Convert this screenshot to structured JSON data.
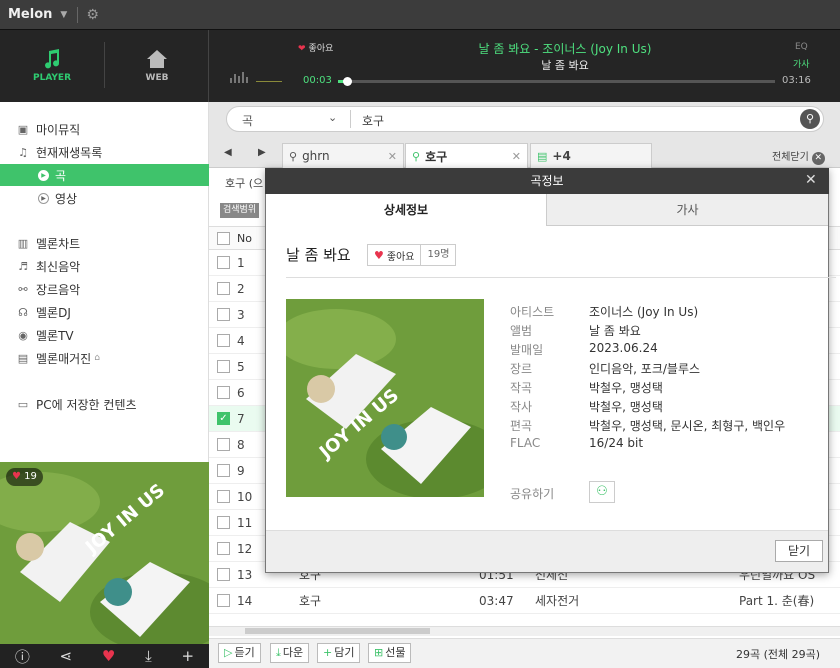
{
  "app": {
    "title": "Melon"
  },
  "player_modes": {
    "player": "PLAYER",
    "web": "WEB"
  },
  "now_playing": {
    "like_label": "좋아요",
    "song_line": "날 좀 봐요 - 조이너스 (Joy In Us)",
    "album_line": "날 좀 봐요",
    "current_time": "00:03",
    "total_time": "03:16",
    "progress": 0.015,
    "eq_label": "EQ",
    "lyrics_label": "가사"
  },
  "sidebar": {
    "my_music": "마이뮤직",
    "now_playlist": "현재재생목록",
    "sub_song": "곡",
    "sub_video": "영상",
    "items": [
      {
        "label": "멜론차트",
        "icon": "chart-icon"
      },
      {
        "label": "최신음악",
        "icon": "music-note-icon"
      },
      {
        "label": "장르음악",
        "icon": "genre-icon"
      },
      {
        "label": "멜론DJ",
        "icon": "headphones-icon"
      },
      {
        "label": "멜론TV",
        "icon": "tv-icon"
      },
      {
        "label": "멜론매거진",
        "icon": "magazine-icon"
      }
    ],
    "pc_content": "PC에 저장한 컨텐츠",
    "art_likes": "19"
  },
  "search": {
    "category": "곡",
    "query": "호구"
  },
  "tabs": [
    {
      "label": "ghrn"
    },
    {
      "label": "호구"
    },
    {
      "label": "+4"
    }
  ],
  "close_all": "전체닫기",
  "result_info": "호구 (으",
  "scope_label": "검색범위",
  "table": {
    "col_no": "No",
    "rows": [
      {
        "no": "1"
      },
      {
        "no": "2"
      },
      {
        "no": "3"
      },
      {
        "no": "4"
      },
      {
        "no": "5"
      },
      {
        "no": "6"
      },
      {
        "no": "7"
      },
      {
        "no": "8"
      },
      {
        "no": "9"
      },
      {
        "no": "10"
      },
      {
        "no": "11"
      },
      {
        "no": "12"
      },
      {
        "no": "13",
        "title": "호구",
        "time": "01:51",
        "artist": "전체전",
        "album": "우린일까요 OS"
      },
      {
        "no": "14",
        "title": "호구",
        "time": "03:47",
        "artist": "세자전거",
        "album": "Part 1. 춘(春)"
      }
    ]
  },
  "bottom": {
    "listen": "듣기",
    "download": "다운",
    "add": "담기",
    "gift": "선물",
    "count": "29곡 (전체 29곡)"
  },
  "modal": {
    "title": "곡정보",
    "tab_detail": "상세정보",
    "tab_lyrics": "가사",
    "song_title": "날 좀 봐요",
    "like_label": "좋아요",
    "like_count": "19명",
    "details": [
      {
        "label": "아티스트",
        "value": "조이너스 (Joy In Us)"
      },
      {
        "label": "앨범",
        "value": "날 좀 봐요"
      },
      {
        "label": "발매일",
        "value": "2023.06.24"
      },
      {
        "label": "장르",
        "value": "인디음악, 포크/블루스"
      },
      {
        "label": "작곡",
        "value": "박철우, 맹성택"
      },
      {
        "label": "작사",
        "value": "박철우, 맹성택"
      },
      {
        "label": "편곡",
        "value": "박철우, 맹성택, 문시온, 최형구, 백인우"
      },
      {
        "label": "FLAC",
        "value": "16/24 bit"
      }
    ],
    "share_label": "공유하기",
    "close_button": "닫기"
  },
  "album_art_text": "JOY IN US",
  "colors": {
    "accent": "#3fc36b",
    "heart": "#e8344e",
    "dark": "#252525"
  }
}
